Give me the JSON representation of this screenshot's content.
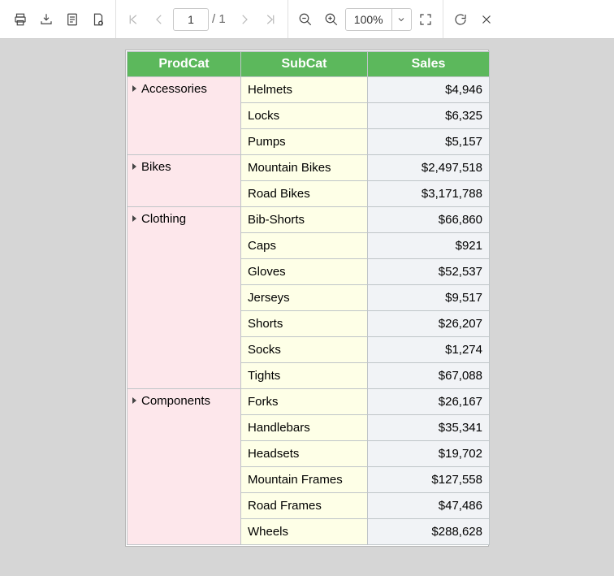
{
  "toolbar": {
    "page_current": "1",
    "page_total_label": "/ 1",
    "zoom_value": "100%"
  },
  "report": {
    "headers": {
      "prodcat": "ProdCat",
      "subcat": "SubCat",
      "sales": "Sales"
    },
    "groups": [
      {
        "prodcat": "Accessories",
        "rows": [
          {
            "subcat": "Helmets",
            "sales": "$4,946"
          },
          {
            "subcat": "Locks",
            "sales": "$6,325"
          },
          {
            "subcat": "Pumps",
            "sales": "$5,157"
          }
        ]
      },
      {
        "prodcat": "Bikes",
        "rows": [
          {
            "subcat": "Mountain Bikes",
            "sales": "$2,497,518"
          },
          {
            "subcat": "Road Bikes",
            "sales": "$3,171,788"
          }
        ]
      },
      {
        "prodcat": "Clothing",
        "rows": [
          {
            "subcat": "Bib-Shorts",
            "sales": "$66,860"
          },
          {
            "subcat": "Caps",
            "sales": "$921"
          },
          {
            "subcat": "Gloves",
            "sales": "$52,537"
          },
          {
            "subcat": "Jerseys",
            "sales": "$9,517"
          },
          {
            "subcat": "Shorts",
            "sales": "$26,207"
          },
          {
            "subcat": "Socks",
            "sales": "$1,274"
          },
          {
            "subcat": "Tights",
            "sales": "$67,088"
          }
        ]
      },
      {
        "prodcat": "Components",
        "rows": [
          {
            "subcat": "Forks",
            "sales": "$26,167"
          },
          {
            "subcat": "Handlebars",
            "sales": "$35,341"
          },
          {
            "subcat": "Headsets",
            "sales": "$19,702"
          },
          {
            "subcat": "Mountain Frames",
            "sales": "$127,558"
          },
          {
            "subcat": "Road Frames",
            "sales": "$47,486"
          },
          {
            "subcat": "Wheels",
            "sales": "$288,628"
          }
        ]
      }
    ]
  }
}
